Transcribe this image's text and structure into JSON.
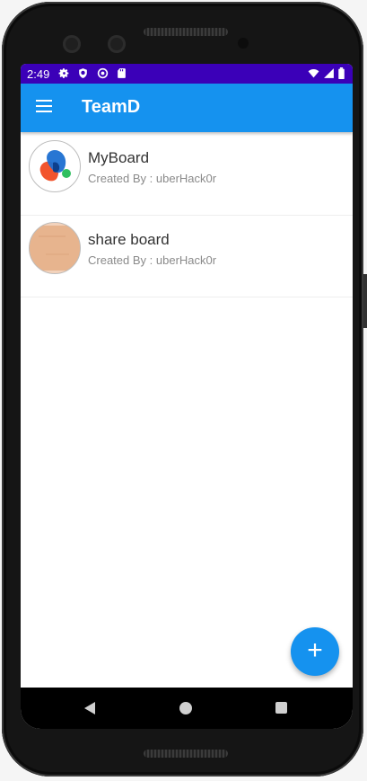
{
  "status_bar": {
    "time": "2:49",
    "icons": [
      "settings-icon",
      "shield-icon",
      "sync-icon",
      "sd-card-icon",
      "wifi-icon",
      "signal-icon",
      "battery-icon"
    ]
  },
  "app_bar": {
    "title": "TeamD",
    "menu_icon": "hamburger-menu-icon"
  },
  "boards": [
    {
      "name": "MyBoard",
      "created_by_label": "Created By : ",
      "creator": "uberHack0r",
      "avatar_icon": "colorful-blob-logo"
    },
    {
      "name": "share board",
      "created_by_label": "Created By : ",
      "creator": "uberHack0r",
      "avatar_icon": "paper-texture-image"
    }
  ],
  "fab": {
    "label": "+",
    "icon": "add-icon"
  },
  "navigation": [
    "back-icon",
    "home-icon",
    "recents-icon"
  ],
  "colors": {
    "status_bar": "#3b00b8",
    "app_bar": "#1592ef",
    "fab": "#1592ef"
  }
}
